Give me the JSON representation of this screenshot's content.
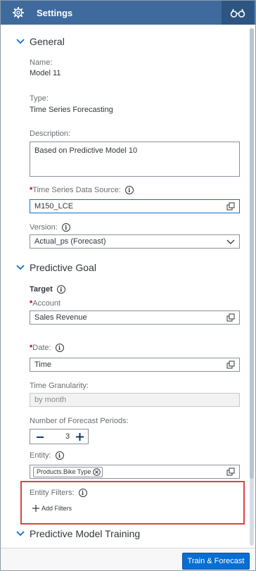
{
  "header": {
    "title": "Settings",
    "left_icon": "gear-icon",
    "right_icon": "glasses-icon"
  },
  "general": {
    "title": "General",
    "name_label": "Name:",
    "name_value": "Model 11",
    "type_label": "Type:",
    "type_value": "Time Series Forecasting",
    "description_label": "Description:",
    "description_value": "Based on Predictive Model 10",
    "datasource_label": "Time Series Data Source:",
    "datasource_value": "M150_LCE",
    "version_label": "Version:",
    "version_value": "Actual_ps (Forecast)"
  },
  "goal": {
    "title": "Predictive Goal",
    "target_label": "Target",
    "account_label": "Account",
    "account_value": "Sales Revenue",
    "date_label": "Date:",
    "date_value": "Time",
    "granularity_label": "Time Granularity:",
    "granularity_placeholder": "by month",
    "periods_label": "Number of Forecast Periods:",
    "periods_value": "3",
    "entity_label": "Entity:",
    "entity_token": "Products.Bike Type",
    "entity_filters_label": "Entity Filters:",
    "add_filters_label": "Add Filters"
  },
  "training": {
    "title": "Predictive Model Training"
  },
  "footer": {
    "button_label": "Train & Forecast"
  },
  "colors": {
    "header_bg": "#3e6a9e",
    "accent": "#0a6ed1",
    "required": "#bb0000",
    "highlight": "#e04040"
  }
}
